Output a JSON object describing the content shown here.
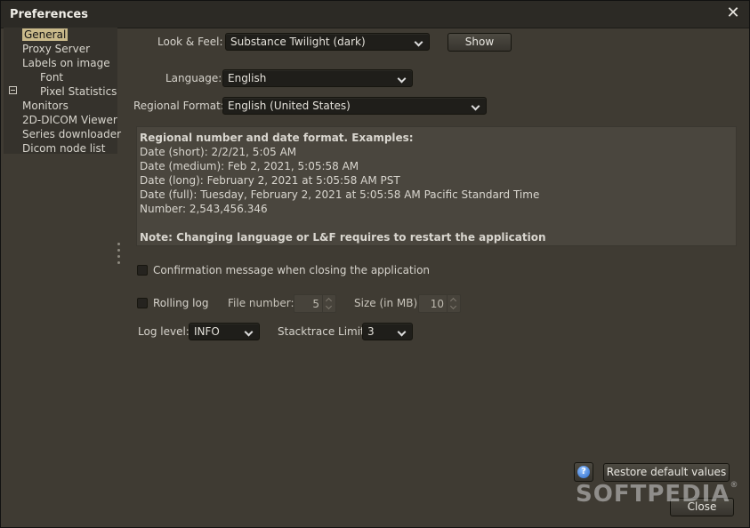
{
  "window": {
    "title": "Preferences"
  },
  "tree": {
    "items": [
      {
        "label": "General",
        "selected": true
      },
      {
        "label": "Proxy Server"
      },
      {
        "label": "Labels on image",
        "expanded": true
      },
      {
        "label": "Font"
      },
      {
        "label": "Pixel Statistics"
      },
      {
        "label": "Monitors"
      },
      {
        "label": "2D-DICOM Viewer"
      },
      {
        "label": "Series downloader"
      },
      {
        "label": "Dicom node list"
      }
    ]
  },
  "look_feel": {
    "label": "Look & Feel:",
    "value": "Substance Twilight (dark)",
    "show_button": "Show"
  },
  "language": {
    "label": "Language:",
    "value": "English"
  },
  "regional": {
    "label": "Regional Format:",
    "value": "English (United States)"
  },
  "info": {
    "heading": "Regional number and date format. Examples:",
    "date_short": "Date (short): 2/2/21, 5:05 AM",
    "date_medium": "Date (medium): Feb 2, 2021, 5:05:58 AM",
    "date_long": "Date (long): February 2, 2021 at 5:05:58 AM PST",
    "date_full": "Date (full): Tuesday, February 2, 2021 at 5:05:58 AM Pacific Standard Time",
    "number": "Number: 2,543,456.346",
    "note": "Note: Changing language or L&F requires to restart the application"
  },
  "confirm_close": {
    "label": "Confirmation message when closing the application",
    "checked": false
  },
  "rolling_log": {
    "label": "Rolling log",
    "checked": false,
    "file_number_label": "File number:",
    "file_number_value": "5",
    "size_label": "Size (in MB):",
    "size_value": "10"
  },
  "log_level": {
    "label": "Log level:",
    "value": "INFO"
  },
  "stacktrace": {
    "label": "Stacktrace Limit:",
    "value": "3"
  },
  "buttons": {
    "help_icon": "?",
    "restore": "Restore default values",
    "close": "Close"
  },
  "watermark": {
    "text": "SOFTPEDIA",
    "mark": "®"
  },
  "colors": {
    "selection": "#c9b98a",
    "background": "#3f3b33",
    "info_panel": "#4a463e"
  }
}
